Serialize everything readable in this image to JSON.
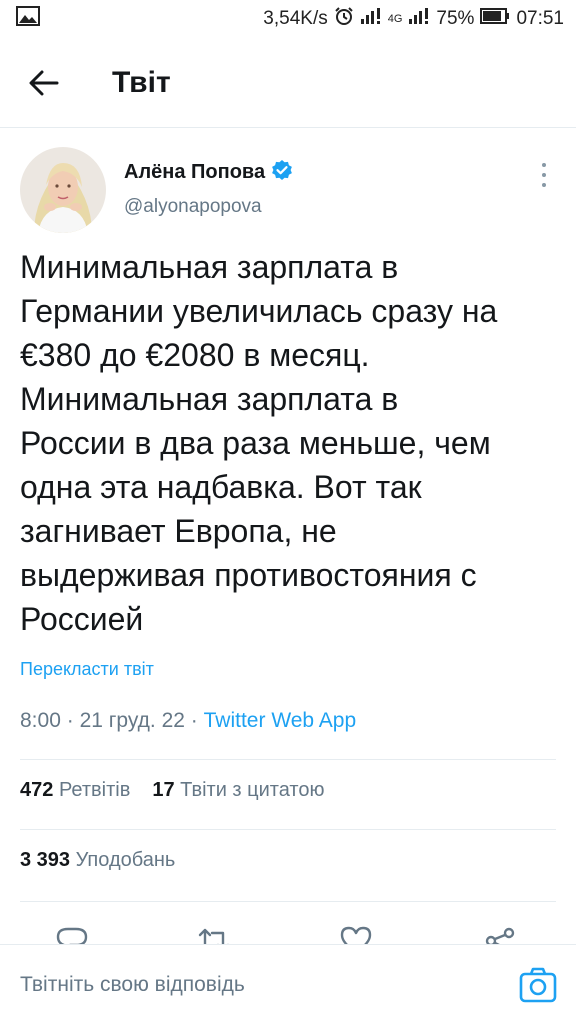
{
  "status_bar": {
    "net_speed": "3,54K/s",
    "network": "4G",
    "battery": "75%",
    "time": "07:51"
  },
  "header": {
    "title": "Твіт"
  },
  "tweet": {
    "author_name": "Алёна Попова",
    "verified": true,
    "handle": "@alyonapopova",
    "text_lines": [
      "Минимальная зарплата в",
      "Германии увеличилась сразу на",
      "€380 до €2080 в месяц.",
      "Минимальная зарплата в",
      "России в два раза меньше, чем",
      "одна эта надбавка. Вот так",
      "загнивает Европа, не",
      "выдерживая противостояния с",
      "Россией"
    ],
    "translate_label": "Перекласти твіт",
    "time": "8:00",
    "separator": "·",
    "date": "21 груд. 22",
    "source": "Twitter Web App",
    "retweets_count": "472",
    "retweets_label": "Ретвітів",
    "quotes_count": "17",
    "quotes_label": "Твіти з цитатою",
    "likes_count": "3 393",
    "likes_label": "Уподобань"
  },
  "actions": [
    "reply-icon",
    "retweet-icon",
    "like-icon",
    "share-icon"
  ],
  "reply_bar": {
    "placeholder": "Твітніть свою відповідь"
  },
  "colors": {
    "accent": "#1da1f2",
    "text": "#14171a",
    "secondary": "#657786",
    "border": "#e6ecf0"
  }
}
